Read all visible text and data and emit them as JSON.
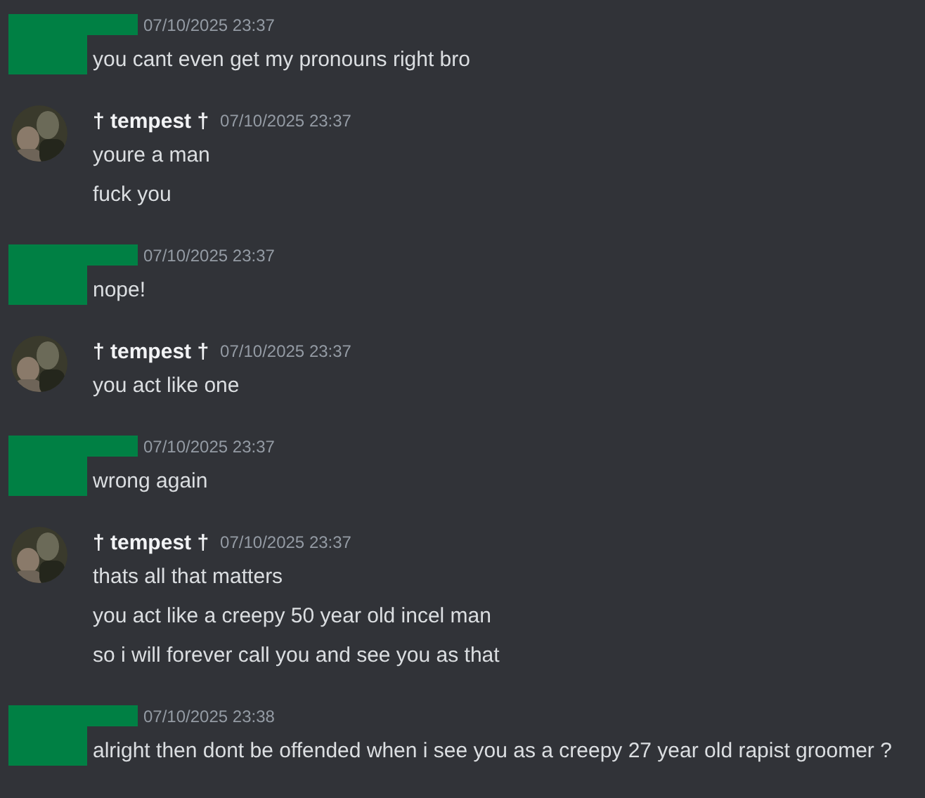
{
  "messages": [
    {
      "kind": "redacted",
      "timestamp": "07/10/2025 23:37",
      "lines": [
        "you cant even get my pronouns right bro"
      ]
    },
    {
      "kind": "user",
      "author": "† tempest †",
      "timestamp": "07/10/2025 23:37",
      "lines": [
        "youre a man",
        "fuck you"
      ]
    },
    {
      "kind": "redacted",
      "timestamp": "07/10/2025 23:37",
      "lines": [
        "nope!"
      ]
    },
    {
      "kind": "user",
      "author": "† tempest †",
      "timestamp": "07/10/2025 23:37",
      "lines": [
        "you act like one"
      ]
    },
    {
      "kind": "redacted",
      "timestamp": "07/10/2025 23:37",
      "lines": [
        "wrong again"
      ]
    },
    {
      "kind": "user",
      "author": "† tempest †",
      "timestamp": "07/10/2025 23:37",
      "lines": [
        "thats all that matters",
        "you act like a creepy 50 year old incel man",
        "so i will forever call you and see you as that"
      ]
    },
    {
      "kind": "redacted",
      "timestamp": "07/10/2025 23:38",
      "lines": [
        "alright then dont be offended when i see you as a creepy 27 year old rapist groomer ?"
      ]
    }
  ]
}
